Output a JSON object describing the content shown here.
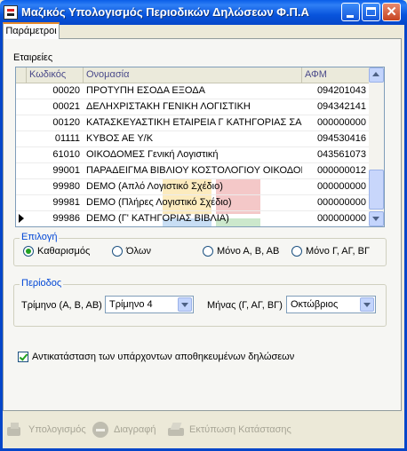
{
  "window": {
    "title": "Μαζικός Υπολογισμός Περιοδικών Δηλώσεων Φ.Π.Α"
  },
  "tabs": [
    {
      "label": "Παράμετροι",
      "active": true
    }
  ],
  "companies": {
    "label": "Εταιρείες",
    "columns": {
      "code": "Κωδικός",
      "name": "Ονομασία",
      "afm": "ΑΦΜ"
    },
    "rows": [
      {
        "code": "00020",
        "name": "ΠΡΟΤΥΠΗ ΕΣΟΔΑ ΕΞΟΔΑ",
        "afm": "094201043",
        "current": false
      },
      {
        "code": "00021",
        "name": "ΔΕΛΗΧΡΙΣΤΑΚΗ ΓΕΝΙΚΗ ΛΟΓΙΣΤΙΚΗ",
        "afm": "094342141",
        "current": false
      },
      {
        "code": "00120",
        "name": "ΚΑΤΑΣΚΕΥΑΣΤΙΚΗ ΕΤΑΙΡΕΙΑ Γ ΚΑΤΗΓΟΡΙΑΣ ΣΑΚ",
        "afm": "000000000",
        "current": false
      },
      {
        "code": "01111",
        "name": "ΚΥΒΟΣ ΑΕ Υ/Κ",
        "afm": "094530416",
        "current": false
      },
      {
        "code": "61010",
        "name": "ΟΙΚΟΔΟΜΕΣ Γενική Λογιστική",
        "afm": "043561073",
        "current": false
      },
      {
        "code": "99001",
        "name": "ΠΑΡΑΔΕΙΓΜΑ ΒΙΒΛΙΟΥ ΚΟΣΤΟΛΟΓΙΟΥ ΟΙΚΟΔΟΜΩ",
        "afm": "000000012",
        "current": false
      },
      {
        "code": "99980",
        "name": "DEMO  (Απλό Λογιστικό Σχέδιο)",
        "afm": "000000000",
        "current": false
      },
      {
        "code": "99981",
        "name": "DEMO  (Πλήρες Λογιστικό Σχέδιο)",
        "afm": "000000000",
        "current": false
      },
      {
        "code": "99986",
        "name": "DEMO  (Γ' ΚΑΤΗΓΟΡΙΑΣ ΒΙΒΛΙΑ)",
        "afm": "000000000",
        "current": true
      }
    ]
  },
  "selection": {
    "legend": "Επιλογή",
    "options": [
      {
        "label": "Καθαρισμός",
        "checked": true
      },
      {
        "label": "Όλων",
        "checked": false
      },
      {
        "label": "Μόνο Α, Β, ΑΒ",
        "checked": false
      },
      {
        "label": "Μόνο Γ, ΑΓ, ΒΓ",
        "checked": false
      }
    ]
  },
  "period": {
    "legend": "Περίοδος",
    "quarter_label": "Τρίμηνο (Α, Β, ΑΒ)",
    "quarter_value": "Τρίμηνο 4",
    "month_label": "Μήνας (Γ, ΑΓ, ΒΓ)",
    "month_value": "Οκτώβριος"
  },
  "replace_checkbox": {
    "label": "Αντικατάσταση των υπάρχοντων αποθηκευμένων δηλώσεων",
    "checked": true
  },
  "footer": {
    "calculate": "Υπολογισμός",
    "delete": "Διαγραφή",
    "print_status": "Εκτύπωση Κατάστασης"
  }
}
